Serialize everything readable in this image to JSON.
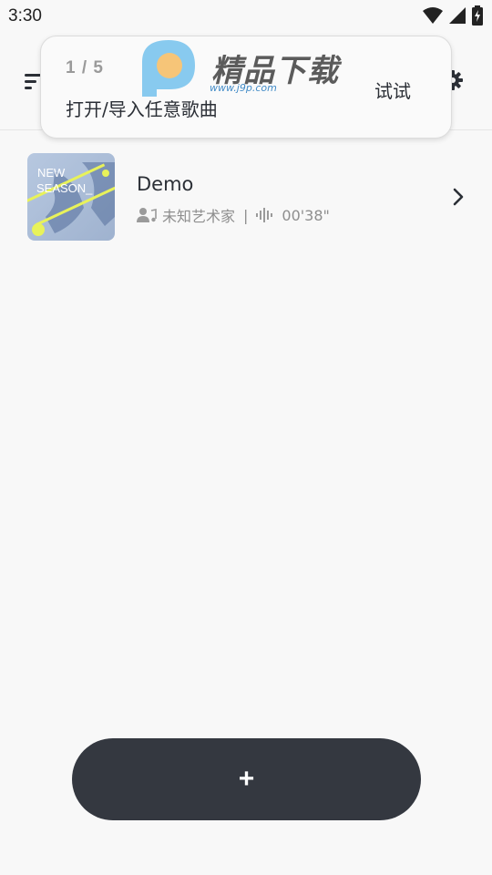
{
  "status_bar": {
    "time": "3:30",
    "icons": [
      "wifi-icon",
      "signal-icon",
      "battery-icon"
    ]
  },
  "app_bar": {
    "left_icon": "sort-icon",
    "right_icon": "gear-icon"
  },
  "guide": {
    "step": "1 / 5",
    "text": "打开/导入任意歌曲",
    "action": "试试"
  },
  "watermark": {
    "title": "精品下载",
    "url": "www.j9p.com"
  },
  "songs": [
    {
      "title": "Demo",
      "artist": "未知艺术家",
      "separator": "|",
      "duration": "00'38\"",
      "cover_text_1": "NEW",
      "cover_text_2": "SEASON_"
    }
  ],
  "fab": {
    "label": "+"
  },
  "colors": {
    "background": "#f8f8f8",
    "fab": "#343840",
    "text_primary": "#2b2f36",
    "text_secondary": "#8e8e8e"
  }
}
